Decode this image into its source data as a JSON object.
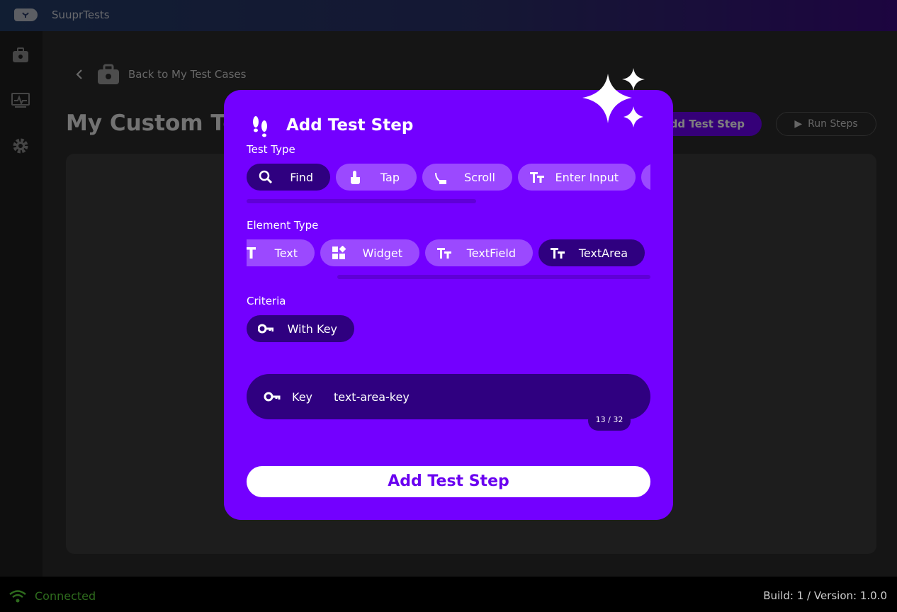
{
  "app": {
    "name": "SuuprTests"
  },
  "sidebar": {
    "items": [
      {
        "icon": "test-cases-icon"
      },
      {
        "icon": "monitor-icon"
      },
      {
        "icon": "gear-icon"
      }
    ]
  },
  "main": {
    "back_label": "Back to My Test Cases",
    "title": "My Custom Test",
    "add_step_label": "Add Test Step",
    "run_label": "Run Steps"
  },
  "dialog": {
    "title": "Add Test Step",
    "test_type": {
      "label": "Test Type",
      "options": [
        "Find",
        "Tap",
        "Scroll",
        "Enter Input"
      ],
      "selected": "Find"
    },
    "element_type": {
      "label": "Element Type",
      "options": [
        "Text",
        "Widget",
        "TextField",
        "TextArea"
      ],
      "selected": "TextArea"
    },
    "criteria": {
      "label": "Criteria",
      "options": [
        "With Key"
      ],
      "selected": "With Key"
    },
    "key_field": {
      "label": "Key",
      "value": "text-area-key",
      "counter": "13 / 32"
    },
    "submit_label": "Add Test Step"
  },
  "status": {
    "connection": "Connected",
    "build": "Build: 1 / Version: 1.0.0"
  },
  "colors": {
    "dialog_bg": "#7300ff",
    "chip_bg": "#9b49ff",
    "chip_selected_bg": "#2f0080",
    "connected": "#2e6b1d"
  }
}
